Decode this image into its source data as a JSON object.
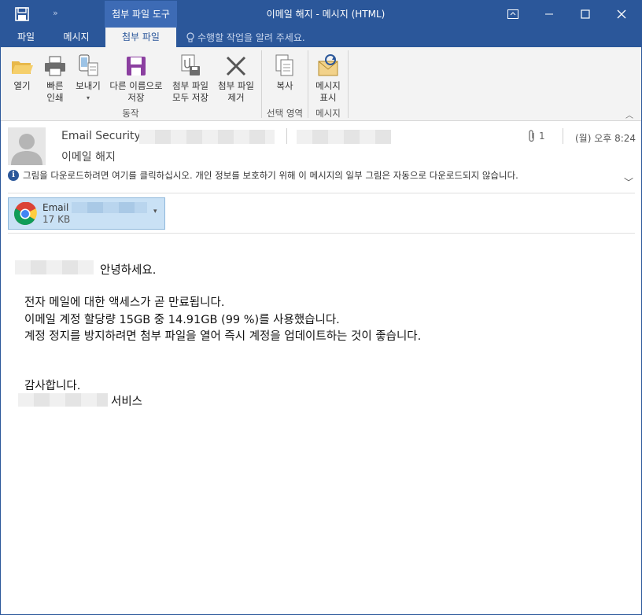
{
  "titlebar": {
    "context_tab": "첨부 파일 도구",
    "window_title": "이메일 해지 - 메시지 (HTML)"
  },
  "tabs": {
    "file": "파일",
    "message": "메시지",
    "attachments": "첨부 파일",
    "tell_me": "수행할 작업을 알려 주세요."
  },
  "ribbon": {
    "open": "열기",
    "quick_print_1": "빠른",
    "quick_print_2": "인쇄",
    "send_to": "보내기",
    "save_as_1": "다른 이름으로",
    "save_as_2": "저장",
    "save_all_1": "첨부 파일",
    "save_all_2": "모두 저장",
    "remove_1": "첨부 파일",
    "remove_2": "제거",
    "copy": "복사",
    "show_message_1": "메시지",
    "show_message_2": "표시",
    "group_actions": "동작",
    "group_selection": "선택 영역",
    "group_message": "메시지"
  },
  "header": {
    "sender": "Email Security",
    "subject": "이메일 해지",
    "attachment_count": "1",
    "date": "(월) 오후 8:24",
    "info_text": "그림을 다운로드하려면 여기를 클릭하십시오. 개인 정보를 보호하기 위해 이 메시지의 일부 그림은 자동으로 다운로드되지 않습니다."
  },
  "attachment": {
    "name": "Email",
    "size": "17 KB"
  },
  "body": {
    "greeting": "안녕하세요.",
    "line1": "전자 메일에 대한 액세스가 곧 만료됩니다.",
    "line2": "이메일 계정 할당량 15GB 중 14.91GB (99 %)를 사용했습니다.",
    "line3": "계정 정지를 방지하려면 첨부 파일을 열어 즉시 계정을 업데이트하는 것이 좋습니다.",
    "thanks": "감사합니다.",
    "signature": "서비스"
  },
  "colors": {
    "accent": "#2b579a",
    "ribbon": "#f3f3f3",
    "attachment_chip": "#c9e1f5"
  }
}
